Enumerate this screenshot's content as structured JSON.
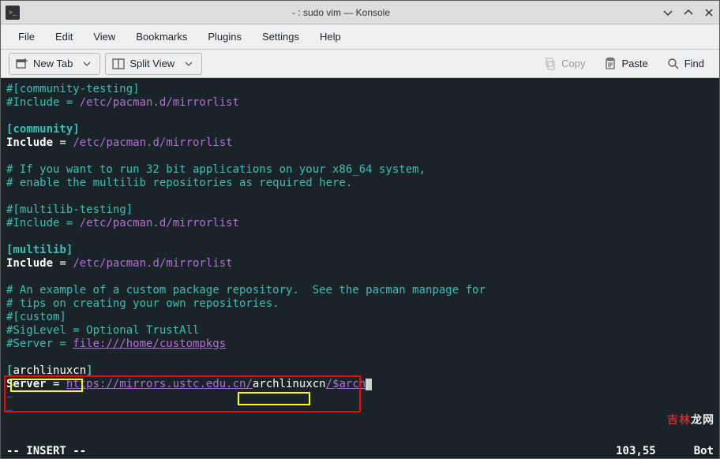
{
  "titlebar": {
    "title": "- : sudo vim — Konsole"
  },
  "menubar": {
    "file": "File",
    "edit": "Edit",
    "view": "View",
    "bookmarks": "Bookmarks",
    "plugins": "Plugins",
    "settings": "Settings",
    "help": "Help"
  },
  "toolbar": {
    "new_tab": "New Tab",
    "split_view": "Split View",
    "copy": "Copy",
    "paste": "Paste",
    "find": "Find"
  },
  "terminal": {
    "l1a": "#[community-testing]",
    "l2a": "#Include = ",
    "l2b": "/etc/pacman.d/mirrorlist",
    "l4a": "[community]",
    "l5a": "Include",
    "l5b": " = ",
    "l5c": "/etc/pacman.d/mirrorlist",
    "l7a": "# If you want to run 32 bit applications on your x86_64 system,",
    "l8a": "# enable the multilib repositories as required here.",
    "l10a": "#[multilib-testing]",
    "l11a": "#Include = ",
    "l11b": "/etc/pacman.d/mirrorlist",
    "l13a": "[multilib]",
    "l14a": "Include",
    "l14b": " = ",
    "l14c": "/etc/pacman.d/mirrorlist",
    "l16a": "# An example of a custom package repository.  See the pacman manpage for",
    "l17a": "# tips on creating your own repositories.",
    "l18a": "#[custom]",
    "l19a": "#SigLevel = Optional TrustAll",
    "l20a": "#Server = ",
    "l20b": "file:///home/custompkgs",
    "l22a": "[",
    "l22b": "archlinuxcn",
    "l22c": "]",
    "l23a": "Server",
    "l23b": " = ",
    "l23c": "https://mirrors.ustc.edu.cn/",
    "l23d": "archlinuxcn",
    "l23e": "/$arch",
    "tilde": "~"
  },
  "status": {
    "mode": "-- INSERT --",
    "pos": "103,55",
    "loc": "Bot"
  },
  "watermark": {
    "red": "吉林",
    "white": "龙网"
  }
}
